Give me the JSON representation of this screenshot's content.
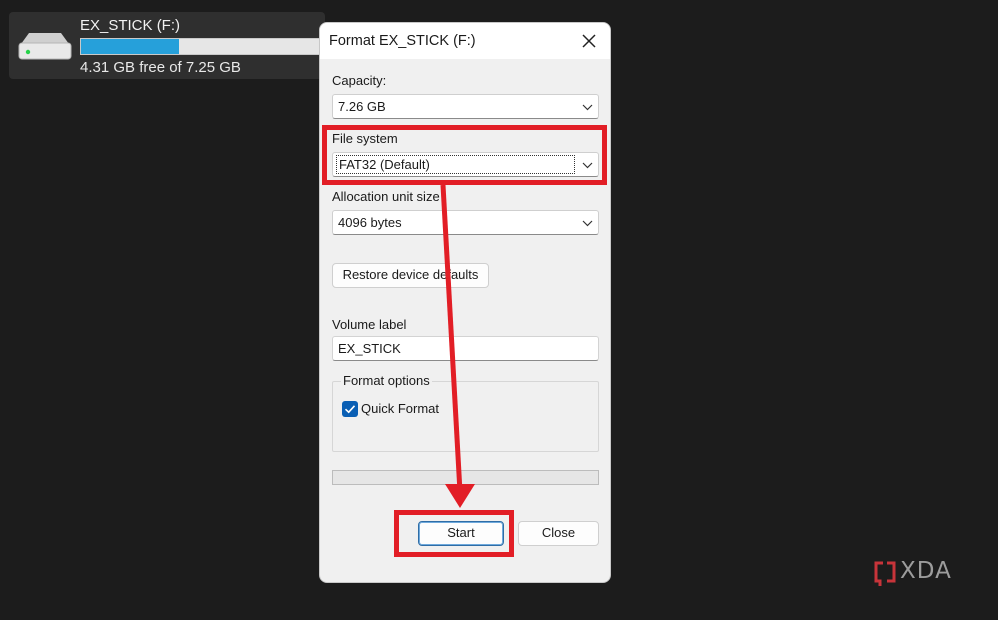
{
  "drive": {
    "name": "EX_STICK (F:)",
    "free_text": "4.31 GB free of 7.25 GB",
    "used_fraction": 0.41,
    "icon": "drive-icon"
  },
  "dialog": {
    "title": "Format EX_STICK (F:)",
    "capacity_label": "Capacity:",
    "capacity_value": "7.26 GB",
    "filesystem_label": "File system",
    "filesystem_value": "FAT32 (Default)",
    "allocation_label": "Allocation unit size",
    "allocation_value": "4096 bytes",
    "restore_button": "Restore device defaults",
    "volume_label_title": "Volume label",
    "volume_label_value": "EX_STICK",
    "format_options_title": "Format options",
    "quick_format_label": "Quick Format",
    "quick_format_checked": true,
    "progress_fraction": 0,
    "start_button": "Start",
    "close_button": "Close"
  },
  "annotation_color": "#e21e26",
  "accent_color": "#26a0da",
  "watermark": {
    "text": "XDA"
  }
}
